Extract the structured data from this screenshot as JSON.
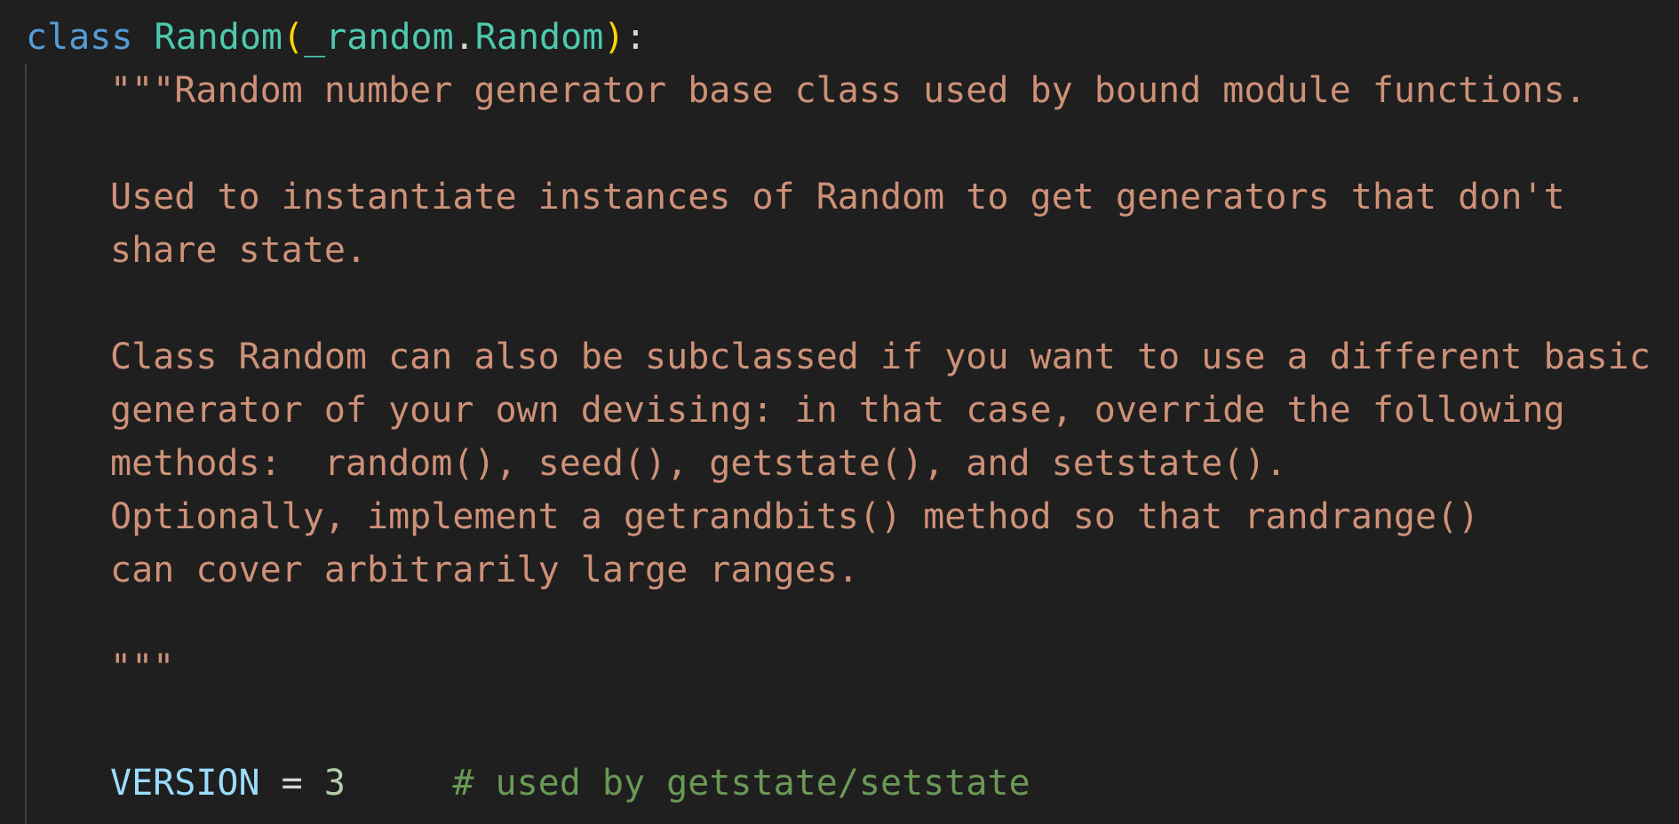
{
  "code": {
    "header": {
      "keyword": "class",
      "class_name": "Random",
      "open_paren": "(",
      "base_module": "_random",
      "dot": ".",
      "base_class": "Random",
      "close_paren": ")",
      "colon": ":"
    },
    "docstring": {
      "line1": "\"\"\"Random number generator base class used by bound module functions.",
      "line3": "Used to instantiate instances of Random to get generators that don't",
      "line4": "share state.",
      "line6": "Class Random can also be subclassed if you want to use a different basic",
      "line7": "generator of your own devising: in that case, override the following",
      "line8": "methods:  random(), seed(), getstate(), and setstate().",
      "line9": "Optionally, implement a getrandbits() method so that randrange()",
      "line10": "can cover arbitrarily large ranges.",
      "close": "\"\"\""
    },
    "version_line": {
      "name": "VERSION",
      "op": " = ",
      "value": "3",
      "gap": "     ",
      "comment": "# used by getstate/setstate"
    }
  },
  "colors": {
    "background": "#1f1f1f",
    "keyword": "#569cd6",
    "class_name": "#4ec9b0",
    "bracket": "#ffd700",
    "string": "#ce9178",
    "variable": "#9cdcfe",
    "number": "#b5cea8",
    "comment": "#6a9955"
  }
}
